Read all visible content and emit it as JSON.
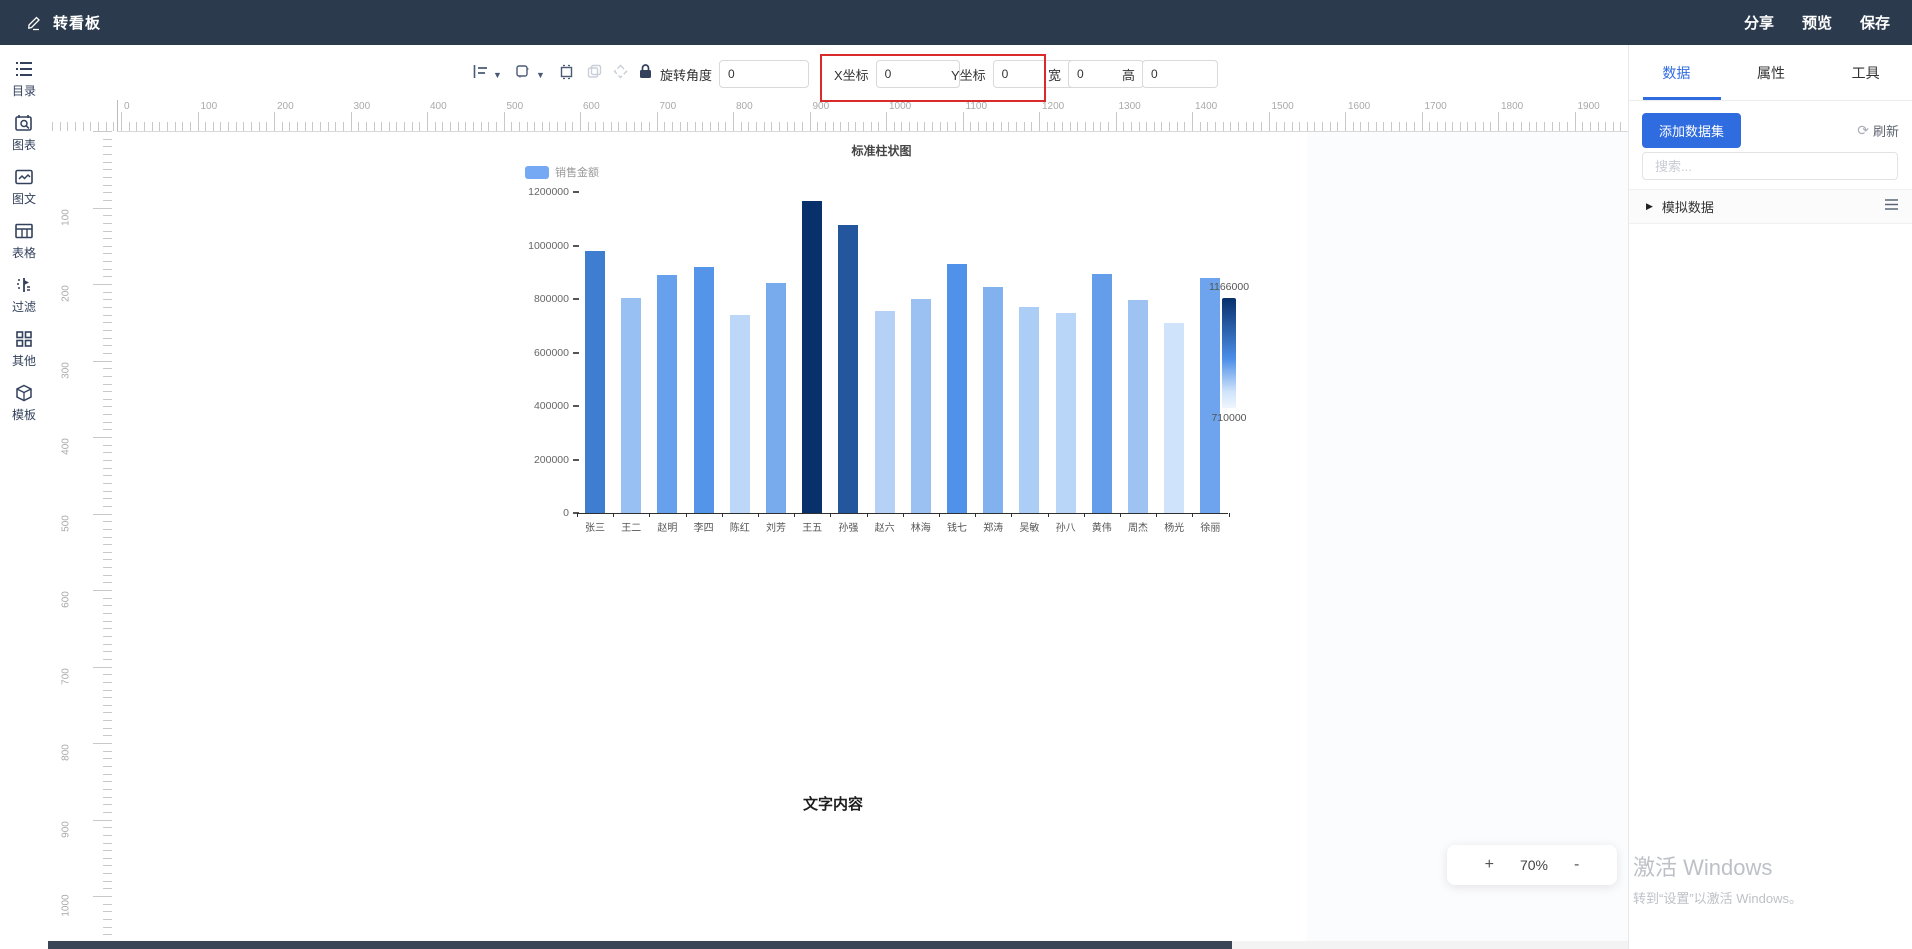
{
  "header": {
    "title": "转看板",
    "actions": [
      {
        "label": "分享"
      },
      {
        "label": "预览"
      },
      {
        "label": "保存"
      }
    ]
  },
  "sidebar": {
    "items": [
      {
        "label": "目录",
        "icon": "catalog-list-icon"
      },
      {
        "label": "图表",
        "icon": "chart-icon"
      },
      {
        "label": "图文",
        "icon": "image-text-icon"
      },
      {
        "label": "表格",
        "icon": "table-icon"
      },
      {
        "label": "过滤",
        "icon": "filter-icon"
      },
      {
        "label": "其他",
        "icon": "grid-icon"
      },
      {
        "label": "模板",
        "icon": "template-box-icon"
      }
    ]
  },
  "toolbar": {
    "fields": [
      {
        "name": "rotation-angle-field",
        "label": "旋转角度",
        "value": "0",
        "highlight": false
      },
      {
        "name": "x-coordinate-field",
        "label": "X坐标",
        "value": "0",
        "highlight": true
      },
      {
        "name": "y-coordinate-field",
        "label": "Y坐标",
        "value": "0",
        "highlight": true
      },
      {
        "name": "width-field",
        "label": "宽",
        "value": "0",
        "highlight": false
      },
      {
        "name": "height-field",
        "label": "高",
        "value": "0",
        "highlight": false
      }
    ]
  },
  "rulers": {
    "h_labels_max": 1900,
    "v_labels_max": 1000,
    "step": 100
  },
  "canvas": {
    "text_element": "文字内容"
  },
  "zoom_control": {
    "plus": "+",
    "value": "70%",
    "minus": "-"
  },
  "watermark": {
    "line1": "激活 Windows",
    "line2": "转到“设置”以激活 Windows。"
  },
  "right_panel": {
    "tabs": [
      {
        "label": "数据",
        "active": true
      },
      {
        "label": "属性",
        "active": false
      },
      {
        "label": "工具",
        "active": false
      }
    ],
    "add_dataset_button": "添加数据集",
    "refresh_label": "刷新",
    "search_placeholder": "搜索...",
    "dataset_item": "模拟数据"
  },
  "chart_data": {
    "type": "bar",
    "title": "标准柱状图",
    "legend": "销售金额",
    "legend_color": "#76a9f4",
    "categories": [
      "张三",
      "王二",
      "赵明",
      "李四",
      "陈红",
      "刘芳",
      "王五",
      "孙强",
      "赵六",
      "林海",
      "钱七",
      "郑涛",
      "吴敏",
      "孙八",
      "黄伟",
      "周杰",
      "杨光",
      "徐丽"
    ],
    "values": [
      980000,
      805000,
      890000,
      920000,
      742000,
      860000,
      1166000,
      1075000,
      755000,
      800000,
      930000,
      845000,
      770000,
      748000,
      895000,
      795000,
      710000,
      880000
    ],
    "ylim": [
      0,
      1200000
    ],
    "y_ticks": [
      0,
      200000,
      400000,
      600000,
      800000,
      1000000,
      1200000
    ],
    "grid": false,
    "visual_map": {
      "max": 1166000,
      "min": 710000,
      "max_label": "1166000",
      "min_label": "710000",
      "color_stops": [
        "#cfe3fa",
        "#4b8ee8",
        "#08306b"
      ]
    }
  }
}
